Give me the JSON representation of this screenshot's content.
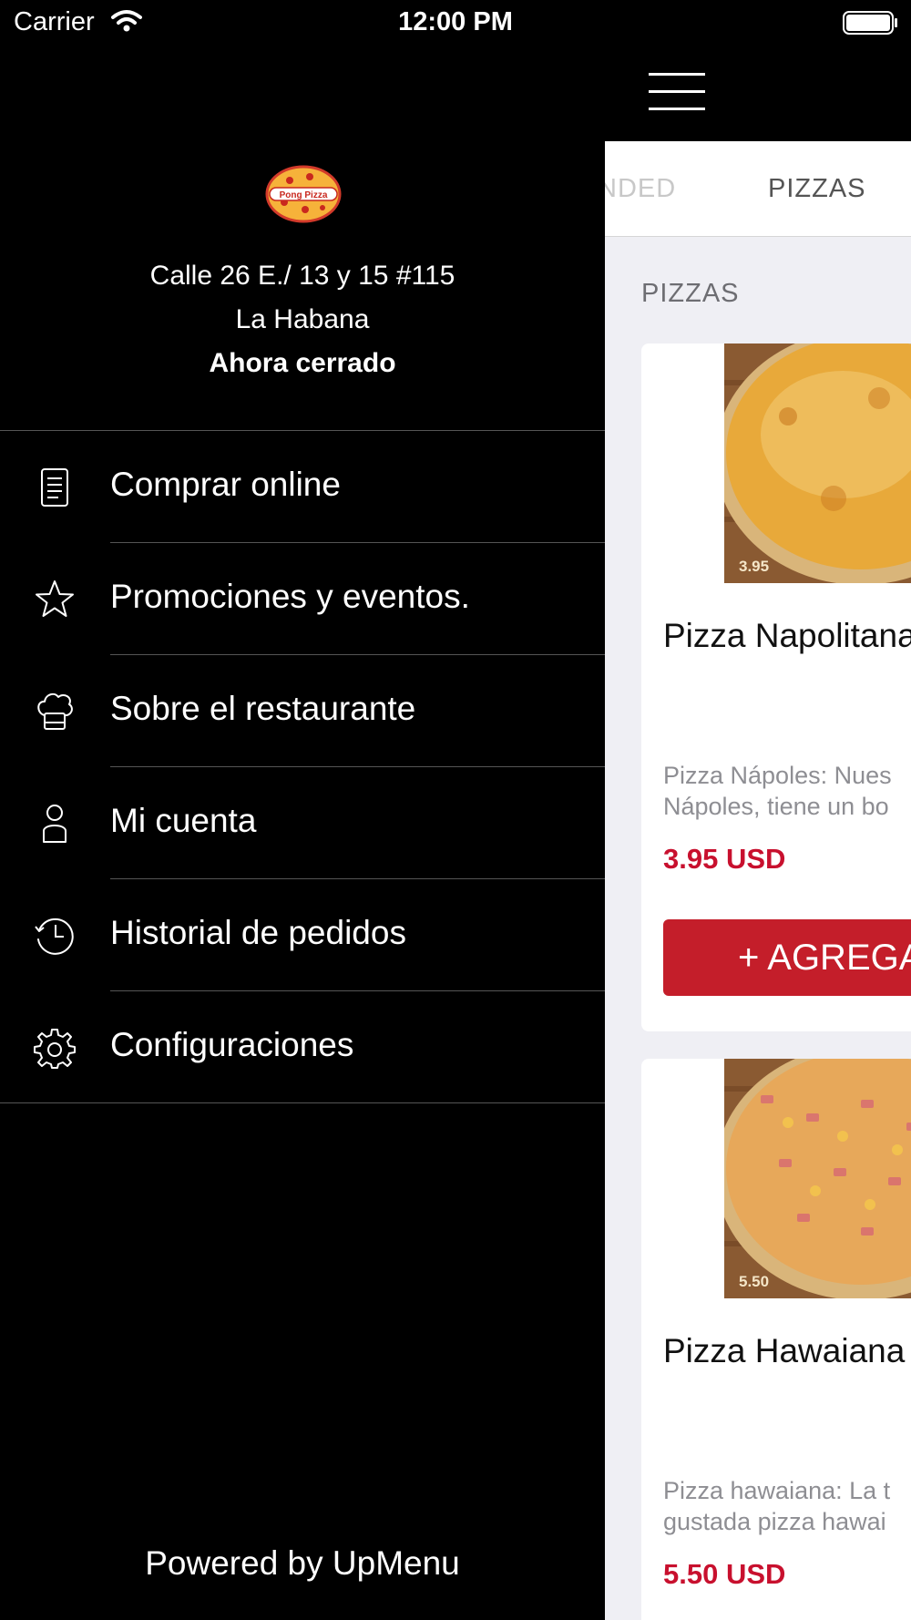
{
  "status_bar": {
    "carrier": "Carrier",
    "time": "12:00 PM"
  },
  "restaurant": {
    "address_line1": "Calle 26 E./ 13 y 15 #115",
    "address_line2": "La Habana",
    "status": "Ahora cerrado",
    "logo_text": "Pong Pizza"
  },
  "menu": {
    "items": [
      {
        "label": "Comprar online",
        "icon": "document-icon"
      },
      {
        "label": "Promociones y eventos.",
        "icon": "star-icon"
      },
      {
        "label": "Sobre el restaurante",
        "icon": "chef-hat-icon"
      },
      {
        "label": "Mi cuenta",
        "icon": "user-icon"
      },
      {
        "label": "Historial de pedidos",
        "icon": "clock-history-icon"
      },
      {
        "label": "Configuraciones",
        "icon": "gear-icon"
      }
    ]
  },
  "footer": {
    "powered_by": "Powered by UpMenu"
  },
  "tabs": [
    {
      "label": "NDED",
      "active": false
    },
    {
      "label": "PIZZAS",
      "active": true
    }
  ],
  "section": {
    "title": "PIZZAS"
  },
  "products": [
    {
      "name": "Pizza Napolitana",
      "price_tag": "3.95",
      "description_line1": "Pizza Nápoles: Nues",
      "description_line2": "Nápoles, tiene un bo",
      "price": "3.95 USD",
      "add_label": "+ AGREGA"
    },
    {
      "name": "Pizza Hawaiana",
      "price_tag": "5.50",
      "description_line1": "Pizza hawaiana: La t",
      "description_line2": "gustada pizza hawai",
      "price": "5.50 USD"
    }
  ],
  "colors": {
    "accent": "#c41e2a",
    "price": "#c8102e",
    "drawer_bg": "#000000",
    "panel_bg": "#efeff4"
  }
}
